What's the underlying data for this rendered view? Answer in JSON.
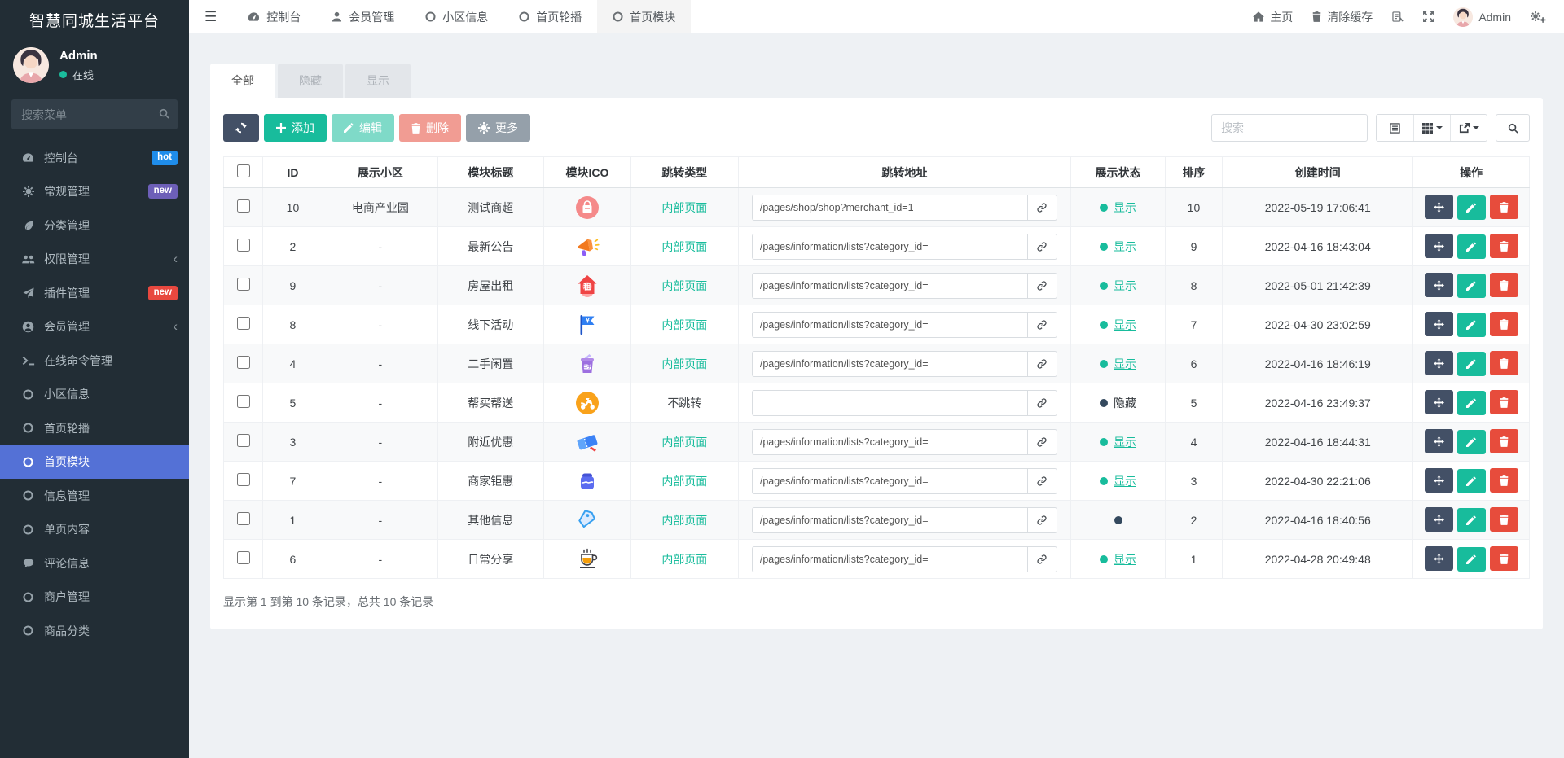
{
  "app": {
    "title": "智慧同城生活平台"
  },
  "sidebar": {
    "user": {
      "name": "Admin",
      "status": "在线"
    },
    "search_placeholder": "搜索菜单",
    "menu": [
      {
        "label": "控制台",
        "icon": "dashboard-icon",
        "badge": "hot",
        "badge_color": "#1f8deb"
      },
      {
        "label": "常规管理",
        "icon": "gear-icon",
        "badge": "new",
        "badge_color": "#6d5fb8"
      },
      {
        "label": "分类管理",
        "icon": "leaf-icon"
      },
      {
        "label": "权限管理",
        "icon": "users-icon",
        "chevron": true
      },
      {
        "label": "插件管理",
        "icon": "rocket-icon",
        "badge": "new",
        "badge_color": "#e8483f"
      },
      {
        "label": "会员管理",
        "icon": "user-circle-icon",
        "chevron": true
      },
      {
        "label": "在线命令管理",
        "icon": "terminal-icon"
      },
      {
        "label": "小区信息",
        "icon": "circle-icon"
      },
      {
        "label": "首页轮播",
        "icon": "circle-icon"
      },
      {
        "label": "首页模块",
        "icon": "circle-icon",
        "active": true
      },
      {
        "label": "信息管理",
        "icon": "circle-icon"
      },
      {
        "label": "单页内容",
        "icon": "circle-icon"
      },
      {
        "label": "评论信息",
        "icon": "comment-icon"
      },
      {
        "label": "商户管理",
        "icon": "circle-icon"
      },
      {
        "label": "商品分类",
        "icon": "circle-icon"
      }
    ]
  },
  "topnav": {
    "tabs": [
      {
        "label": "控制台",
        "icon": "dashboard-icon"
      },
      {
        "label": "会员管理",
        "icon": "user-icon"
      },
      {
        "label": "小区信息",
        "icon": "circle-icon"
      },
      {
        "label": "首页轮播",
        "icon": "circle-icon"
      },
      {
        "label": "首页模块",
        "icon": "circle-icon",
        "active": true
      }
    ],
    "right": {
      "home": "主页",
      "clear_cache": "清除缓存",
      "username": "Admin"
    }
  },
  "filter_tabs": [
    {
      "label": "全部",
      "active": true
    },
    {
      "label": "隐藏"
    },
    {
      "label": "显示"
    }
  ],
  "toolbar": {
    "add_label": "添加",
    "edit_label": "编辑",
    "delete_label": "删除",
    "more_label": "更多",
    "search_placeholder": "搜索"
  },
  "table": {
    "columns": [
      "ID",
      "展示小区",
      "模块标题",
      "模块ICO",
      "跳转类型",
      "跳转地址",
      "展示状态",
      "排序",
      "创建时间",
      "操作"
    ],
    "rows": [
      {
        "id": "10",
        "community": "电商产业园",
        "title": "测试商超",
        "icon": "shop-bag-icon",
        "jump_type": "内部页面",
        "jump_internal": true,
        "url": "/pages/shop/shop?merchant_id=1",
        "status_label": "显示",
        "status_type": "show",
        "sort": "10",
        "created": "2022-05-19 17:06:41"
      },
      {
        "id": "2",
        "community": "-",
        "title": "最新公告",
        "icon": "megaphone-icon",
        "jump_type": "内部页面",
        "jump_internal": true,
        "url": "/pages/information/lists?category_id=",
        "status_label": "显示",
        "status_type": "show",
        "sort": "9",
        "created": "2022-04-16 18:43:04"
      },
      {
        "id": "9",
        "community": "-",
        "title": "房屋出租",
        "icon": "house-rent-icon",
        "jump_type": "内部页面",
        "jump_internal": true,
        "url": "/pages/information/lists?category_id=",
        "status_label": "显示",
        "status_type": "show",
        "sort": "8",
        "created": "2022-05-01 21:42:39"
      },
      {
        "id": "8",
        "community": "-",
        "title": "线下活动",
        "icon": "flag-icon",
        "jump_type": "内部页面",
        "jump_internal": true,
        "url": "/pages/information/lists?category_id=",
        "status_label": "显示",
        "status_type": "show",
        "sort": "7",
        "created": "2022-04-30 23:02:59"
      },
      {
        "id": "4",
        "community": "-",
        "title": "二手闲置",
        "icon": "secondhand-icon",
        "jump_type": "内部页面",
        "jump_internal": true,
        "url": "/pages/information/lists?category_id=",
        "status_label": "显示",
        "status_type": "show",
        "sort": "6",
        "created": "2022-04-16 18:46:19"
      },
      {
        "id": "5",
        "community": "-",
        "title": "帮买帮送",
        "icon": "scooter-icon",
        "jump_type": "不跳转",
        "jump_internal": false,
        "url": "",
        "status_label": "隐藏",
        "status_type": "hide",
        "sort": "5",
        "created": "2022-04-16 23:49:37"
      },
      {
        "id": "3",
        "community": "-",
        "title": "附近优惠",
        "icon": "coupon-icon",
        "jump_type": "内部页面",
        "jump_internal": true,
        "url": "/pages/information/lists?category_id=",
        "status_label": "显示",
        "status_type": "show",
        "sort": "4",
        "created": "2022-04-16 18:44:31"
      },
      {
        "id": "7",
        "community": "-",
        "title": "商家钜惠",
        "icon": "shop-jar-icon",
        "jump_type": "内部页面",
        "jump_internal": true,
        "url": "/pages/information/lists?category_id=",
        "status_label": "显示",
        "status_type": "show",
        "sort": "3",
        "created": "2022-04-30 22:21:06"
      },
      {
        "id": "1",
        "community": "-",
        "title": "其他信息",
        "icon": "tag-icon",
        "jump_type": "内部页面",
        "jump_internal": true,
        "url": "/pages/information/lists?category_id=",
        "status_label": "",
        "status_type": "dot",
        "sort": "2",
        "created": "2022-04-16 18:40:56"
      },
      {
        "id": "6",
        "community": "-",
        "title": "日常分享",
        "icon": "coffee-icon",
        "jump_type": "内部页面",
        "jump_internal": true,
        "url": "/pages/information/lists?category_id=",
        "status_label": "显示",
        "status_type": "show",
        "sort": "1",
        "created": "2022-04-28 20:49:48"
      }
    ],
    "footer": "显示第 1 到第 10 条记录，总共 10 条记录"
  },
  "colors": {
    "accent": "#18bc9c",
    "danger": "#e74c3c",
    "dark_button": "#435066",
    "active_menu": "#5471d6",
    "status_hide_dot": "#34495e"
  }
}
